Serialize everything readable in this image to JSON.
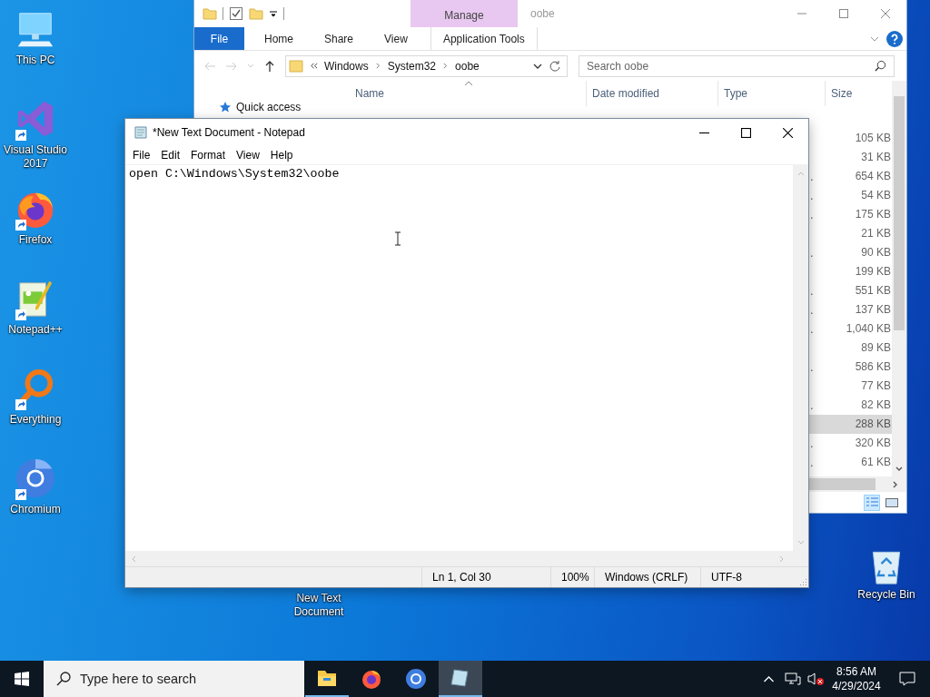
{
  "desktop_icons": [
    {
      "label": "This PC",
      "kind": "pc",
      "shortcut": false
    },
    {
      "label": "Visual Studio 2017",
      "kind": "vs",
      "shortcut": true
    },
    {
      "label": "Firefox",
      "kind": "firefox",
      "shortcut": true
    },
    {
      "label": "Notepad++",
      "kind": "notepadpp",
      "shortcut": true
    },
    {
      "label": "Everything",
      "kind": "everything",
      "shortcut": true
    },
    {
      "label": "Chromium",
      "kind": "chromium",
      "shortcut": true
    }
  ],
  "recycle_bin": {
    "label": "Recycle Bin"
  },
  "desktop_file": {
    "label": "New Text Document"
  },
  "explorer": {
    "context_tab": "Manage",
    "title": "oobe",
    "ribbon_tabs": [
      {
        "label": "File",
        "kind": "file"
      },
      {
        "label": "Home",
        "kind": "normal"
      },
      {
        "label": "Share",
        "kind": "normal"
      },
      {
        "label": "View",
        "kind": "normal"
      },
      {
        "label": "Application Tools",
        "kind": "context"
      }
    ],
    "breadcrumb": [
      "Windows",
      "System32",
      "oobe"
    ],
    "search": {
      "placeholder": "Search oobe"
    },
    "columns": [
      "Name",
      "Date modified",
      "Type",
      "Size"
    ],
    "nav_items": [
      {
        "label": "Quick access"
      }
    ],
    "rows": [
      {
        "size": "105 KB",
        "selected": false
      },
      {
        "size": "31 KB",
        "selected": false
      },
      {
        "type": "…",
        "size": "654 KB",
        "selected": false
      },
      {
        "type": "…",
        "size": "54 KB",
        "selected": false
      },
      {
        "type": "…",
        "size": "175 KB",
        "selected": false
      },
      {
        "size": "21 KB",
        "selected": false
      },
      {
        "type": "…",
        "size": "90 KB",
        "selected": false
      },
      {
        "size": "199 KB",
        "selected": false
      },
      {
        "type": "…",
        "size": "551 KB",
        "selected": false
      },
      {
        "type": "…",
        "size": "137 KB",
        "selected": false
      },
      {
        "type": "…",
        "size": "1,040 KB",
        "selected": false
      },
      {
        "size": "89 KB",
        "selected": false
      },
      {
        "type": "…",
        "size": "586 KB",
        "selected": false
      },
      {
        "size": "77 KB",
        "selected": false
      },
      {
        "type": "…",
        "size": "82 KB",
        "selected": false
      },
      {
        "size": "288 KB",
        "selected": true
      },
      {
        "type": "…",
        "size": "320 KB",
        "selected": false
      },
      {
        "type": "…",
        "size": "61 KB",
        "selected": false
      }
    ]
  },
  "notepad": {
    "title": "*New Text Document - Notepad",
    "menu": [
      "File",
      "Edit",
      "Format",
      "View",
      "Help"
    ],
    "text": "open C:\\Windows\\System32\\oobe",
    "status": [
      "Ln 1, Col 30",
      "100%",
      "Windows (CRLF)",
      "UTF-8"
    ]
  },
  "taskbar": {
    "search": {
      "placeholder": "Type here to search"
    },
    "apps": [
      {
        "kind": "explorer",
        "running": true,
        "active": false
      },
      {
        "kind": "firefox",
        "running": false,
        "active": false
      },
      {
        "kind": "chromium",
        "running": false,
        "active": false
      },
      {
        "kind": "notepad",
        "running": true,
        "active": true
      }
    ],
    "time": "8:56 AM",
    "date": "4/29/2024",
    "muted": true
  }
}
